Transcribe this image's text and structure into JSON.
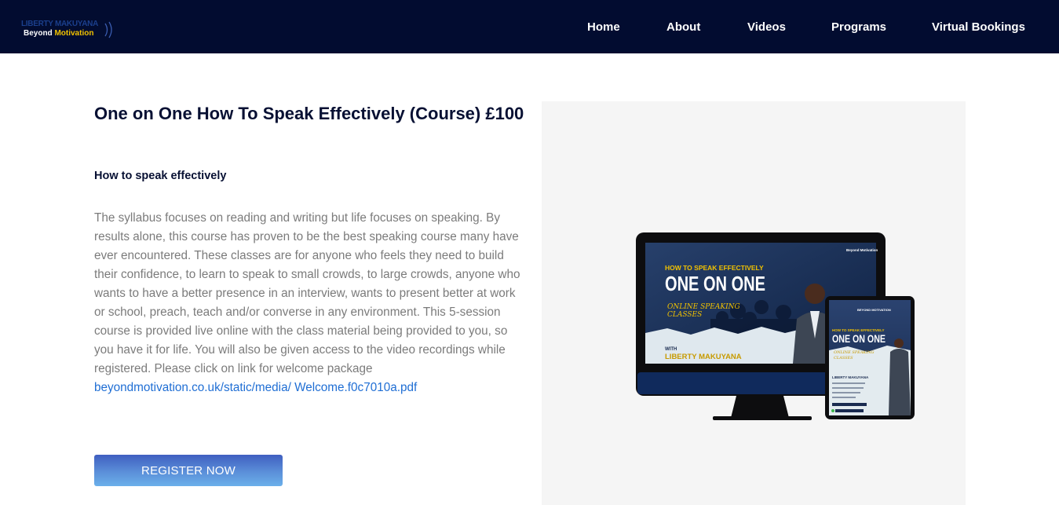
{
  "nav": {
    "logo_top": "LIBERTY MAKUYANA",
    "logo_bottom_1": "Beyond",
    "logo_bottom_2": "Motivation",
    "links": [
      "Home",
      "About",
      "Videos",
      "Programs",
      "Virtual Bookings"
    ]
  },
  "course": {
    "title": "One on One How To Speak Effectively (Course) £100",
    "subtitle": "How to speak effectively",
    "description": "The syllabus focuses on reading and writing but life focuses on speaking. By results alone, this course has proven to be the best speaking course many have ever encountered. These classes are for anyone who feels they need to build their confidence, to learn to speak to small crowds, to large crowds, anyone who wants to have a better presence in an interview, wants to present better at work or school, preach, teach and/or converse in any environment. This 5-session course is provided live online with the class material being provided to you, so you have it for life. You will also be given access to the video recordings while registered. Please click on link for welcome package ",
    "link_text": "beyondmotivation.co.uk/static/media/ Welcome.f0c7010a.pdf",
    "register_label": "REGISTER NOW"
  },
  "promo": {
    "brand": "Beyond Motivation",
    "brand_tablet": "BEYOND MOTIVATION",
    "headline_small": "HOW TO SPEAK EFFECTIVELY",
    "headline_big": "ONE ON ONE",
    "tagline_line1": "ONLINE SPEAKING",
    "tagline_line2": "CLASSES",
    "with": "WITH",
    "name": "LIBERTY MAKUYANA"
  },
  "colors": {
    "navbar": "#020c30",
    "heading": "#071033",
    "body_text": "#7b7b7b",
    "link": "#1f6ed4",
    "accent_yellow": "#f2c200"
  }
}
